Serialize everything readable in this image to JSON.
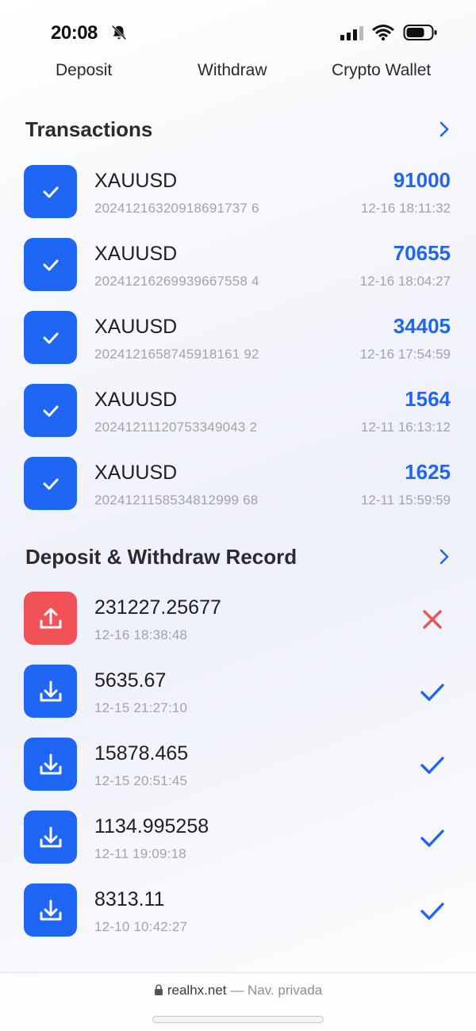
{
  "status_bar": {
    "time": "20:08"
  },
  "top_tabs": [
    {
      "label": "Deposit"
    },
    {
      "label": "Withdraw"
    },
    {
      "label": "Crypto Wallet"
    }
  ],
  "transactions": {
    "title": "Transactions",
    "items": [
      {
        "symbol": "XAUUSD",
        "order_id": "20241216320918691737 6",
        "amount": "91000",
        "time": "12-16 18:11:32"
      },
      {
        "symbol": "XAUUSD",
        "order_id": "20241216269939667558 4",
        "amount": "70655",
        "time": "12-16 18:04:27"
      },
      {
        "symbol": "XAUUSD",
        "order_id": "2024121658745918161 92",
        "amount": "34405",
        "time": "12-16 17:54:59"
      },
      {
        "symbol": "XAUUSD",
        "order_id": "20241211120753349043 2",
        "amount": "1564",
        "time": "12-11 16:13:12"
      },
      {
        "symbol": "XAUUSD",
        "order_id": "2024121158534812999 68",
        "amount": "1625",
        "time": "12-11 15:59:59"
      }
    ]
  },
  "records": {
    "title": "Deposit & Withdraw Record",
    "items": [
      {
        "amount": "231227.25677",
        "time": "12-16 18:38:48",
        "type": "withdraw",
        "status": "failed"
      },
      {
        "amount": "5635.67",
        "time": "12-15 21:27:10",
        "type": "deposit",
        "status": "success"
      },
      {
        "amount": "15878.465",
        "time": "12-15 20:51:45",
        "type": "deposit",
        "status": "success"
      },
      {
        "amount": "1134.995258",
        "time": "12-11 19:09:18",
        "type": "deposit",
        "status": "success"
      },
      {
        "amount": "8313.11",
        "time": "12-10 10:42:27",
        "type": "deposit",
        "status": "success"
      }
    ]
  },
  "browser": {
    "domain": "realhx.net",
    "mode": "— Nav. privada"
  },
  "colors": {
    "accent": "#1f66f5",
    "danger": "#f05257",
    "muted": "#a3a3a8"
  },
  "icons": {
    "transaction": "checkmark-icon",
    "withdraw": "upload-icon",
    "deposit": "download-icon",
    "success": "checkmark-icon",
    "failed": "x-mark-icon"
  }
}
